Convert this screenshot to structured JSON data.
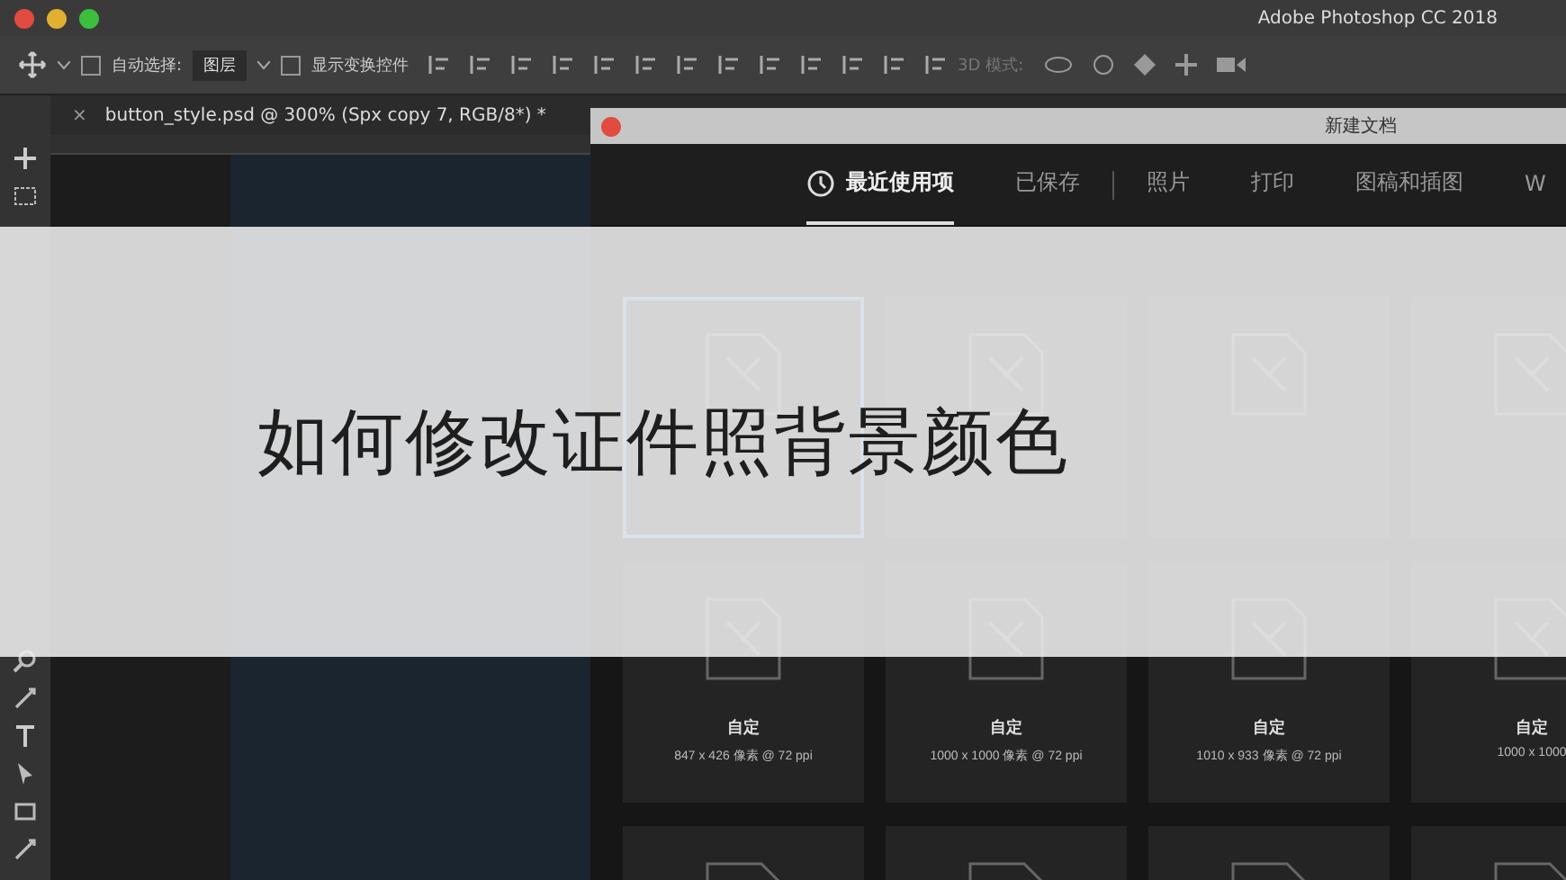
{
  "window": {
    "title": "Adobe Photoshop CC 2018"
  },
  "options_bar": {
    "auto_select": {
      "label": "自动选择:",
      "checked": false
    },
    "layer_dropdown": "图层",
    "show_transform": {
      "label": "显示变换控件",
      "checked": false
    },
    "mode_3d_label": "3D 模式:"
  },
  "document_tab": {
    "close": "×",
    "title": "button_style.psd @ 300% (Spx copy 7, RGB/8*) *"
  },
  "dialog": {
    "title": "新建文档",
    "tabs": [
      {
        "label": "最近使用项",
        "selected": true,
        "separator_before": false
      },
      {
        "label": "已保存",
        "selected": false,
        "separator_before": false
      },
      {
        "label": "照片",
        "selected": false,
        "separator_before": true
      },
      {
        "label": "打印",
        "selected": false,
        "separator_before": false
      },
      {
        "label": "图稿和插图",
        "selected": false,
        "separator_before": false
      },
      {
        "label": "W",
        "selected": false,
        "separator_before": false
      }
    ],
    "presets": [
      {
        "selected": true
      },
      {
        "selected": false
      },
      {
        "selected": false
      },
      {
        "selected": false
      },
      {
        "name": "自定",
        "size": "847 x 426 像素 @ 72 ppi",
        "selected": false
      },
      {
        "name": "自定",
        "size": "1000 x 1000 像素 @ 72 ppi",
        "selected": false
      },
      {
        "name": "自定",
        "size": "1010 x 933 像素 @ 72 ppi",
        "selected": false
      },
      {
        "name": "自定",
        "size": "1000 x 1000",
        "selected": false
      },
      {
        "selected": false
      },
      {
        "selected": false
      },
      {
        "selected": false
      },
      {
        "selected": false
      }
    ]
  },
  "banner": {
    "title": "如何修改证件照背景颜色"
  }
}
